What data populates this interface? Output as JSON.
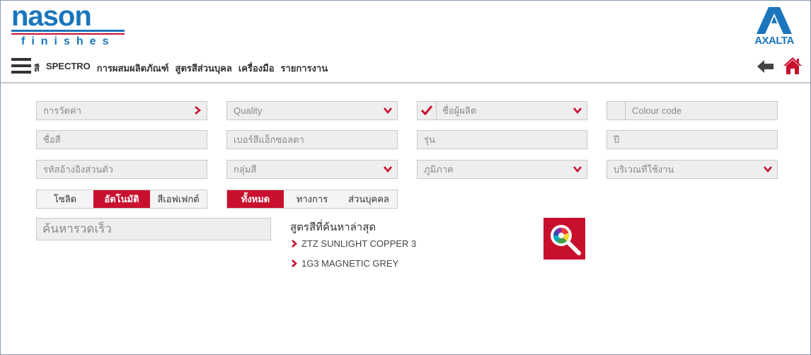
{
  "brand": {
    "logo_main": "nason",
    "logo_sub": "finishes",
    "partner": "AXALTA"
  },
  "nav": {
    "items": [
      "สี",
      "SPECTRO",
      "การผสมผลิตภัณฑ์",
      "สูตรสีส่วนบุคล",
      "เครื่องมือ",
      "รายการงาน"
    ]
  },
  "icons": {
    "menu": "hamburger-icon",
    "back": "arrow-left-icon",
    "home": "home-icon",
    "dropdown": "chevron-down-icon",
    "go": "chevron-right-icon",
    "check": "check-icon",
    "search": "color-search-icon"
  },
  "colors": {
    "accent": "#c8102e",
    "brand_blue": "#1b75bc",
    "field_bg": "#eeeeee"
  },
  "form": {
    "row1": {
      "measurement": "การวัดค่า",
      "quality": "Quality",
      "manufacturer": "ชื่อผู้ผลิต",
      "colour_code": "Colour code"
    },
    "row2": {
      "colour_name": "ชื่อสี",
      "doc_number": "เบอร์สีแอ็กซอลตา",
      "model": "รุ่น",
      "year": "ปี"
    },
    "row3": {
      "part_ref": "รหัสอ้างอิงส่วนตัว",
      "colour_group": "กลุ่มสี",
      "region": "ภูมิภาค",
      "usage_area": "บริเวณที่ใช้งาน"
    },
    "finish_toggle": {
      "options": [
        "โซลิด",
        "อัตโนมัติ",
        "สีเอฟเฟกต์"
      ],
      "selected": "อัตโนมัติ"
    },
    "scope_toggle": {
      "options": [
        "ทั้งหมด",
        "ทางการ",
        "ส่วนบุคคล"
      ],
      "selected": "ทั้งหมด"
    },
    "quick_search_placeholder": "ค้นหารวดเร็ว"
  },
  "recent": {
    "title": "สูตรสีที่ค้นหาล่าสุด",
    "items": [
      "ZTZ SUNLIGHT COPPER 3",
      "1G3 MAGNETIC GREY"
    ]
  }
}
